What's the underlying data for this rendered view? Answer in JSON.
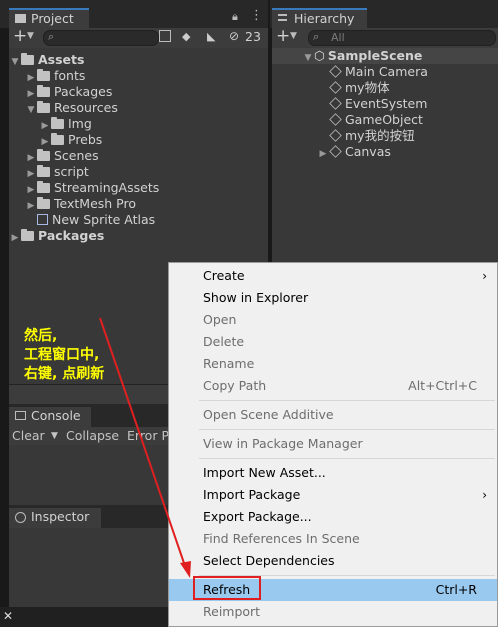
{
  "project": {
    "tab": "Project",
    "add": "+",
    "hidden_count": "23",
    "assets_label": "Assets",
    "tree": [
      {
        "label": "fonts"
      },
      {
        "label": "Packages"
      },
      {
        "label": "Resources"
      },
      {
        "label": "Img"
      },
      {
        "label": "Prebs"
      },
      {
        "label": "Scenes"
      },
      {
        "label": "script"
      },
      {
        "label": "StreamingAssets"
      },
      {
        "label": "TextMesh Pro"
      },
      {
        "label": "New Sprite Atlas"
      }
    ],
    "packages_label": "Packages"
  },
  "hierarchy": {
    "tab": "Hierarchy",
    "add": "+",
    "search_placeholder": "All",
    "scene": "SampleScene",
    "items": [
      {
        "label": "Main Camera"
      },
      {
        "label": "my物体"
      },
      {
        "label": "EventSystem"
      },
      {
        "label": "GameObject"
      },
      {
        "label": "my我的按钮"
      },
      {
        "label": "Canvas"
      }
    ]
  },
  "console": {
    "tab": "Console",
    "clear": "Clear",
    "collapse": "Collapse",
    "error_pause": "Error Pa"
  },
  "inspector": {
    "tab": "Inspector"
  },
  "annotation": {
    "line1": "然后,",
    "line2": "工程窗口中,",
    "line3": "右键, 点刷新",
    "color": "#ffff00"
  },
  "menu": {
    "items": [
      {
        "label": "Create",
        "submenu": "›"
      },
      {
        "label": "Show in Explorer"
      },
      {
        "label": "Open"
      },
      {
        "label": "Delete"
      },
      {
        "label": "Rename"
      },
      {
        "label": "Copy Path",
        "shortcut": "Alt+Ctrl+C"
      },
      {
        "label": "Open Scene Additive"
      },
      {
        "label": "View in Package Manager"
      },
      {
        "label": "Import New Asset..."
      },
      {
        "label": "Import Package",
        "submenu": "›"
      },
      {
        "label": "Export Package..."
      },
      {
        "label": "Find References In Scene"
      },
      {
        "label": "Select Dependencies"
      },
      {
        "label": "Refresh",
        "shortcut": "Ctrl+R"
      },
      {
        "label": "Reimport"
      }
    ],
    "highlight_color": "#99c9ef",
    "box_color": "#e02020"
  },
  "bottom": {
    "close": "✕"
  }
}
